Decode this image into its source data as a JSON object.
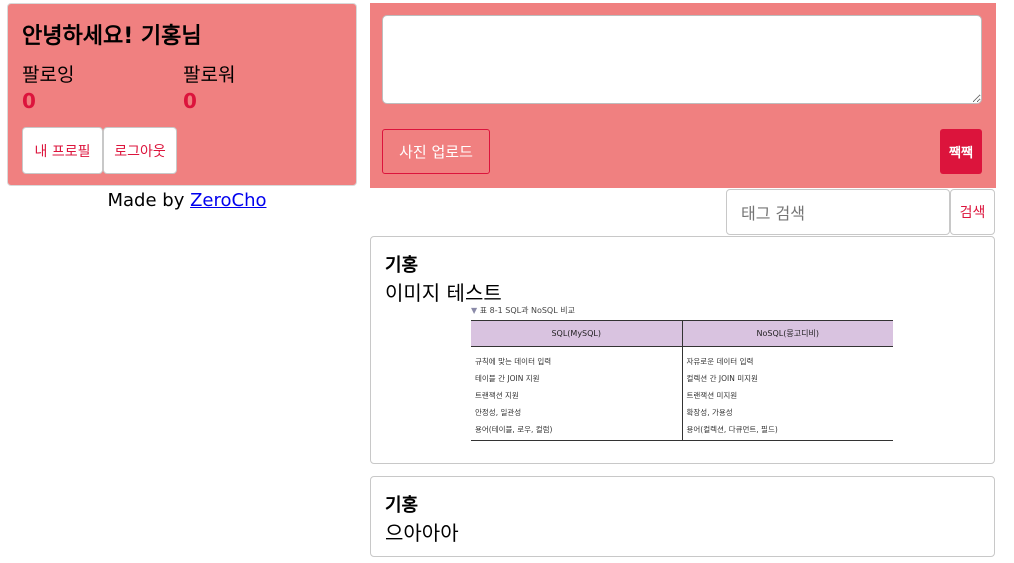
{
  "profile": {
    "greeting": "안녕하세요! 기홍님",
    "following_label": "팔로잉",
    "following_count": "0",
    "follower_label": "팔로워",
    "follower_count": "0",
    "my_profile_button": "내 프로필",
    "logout_button": "로그아웃"
  },
  "footer": {
    "made_by_prefix": "Made by ",
    "made_by_link": "ZeroCho"
  },
  "composer": {
    "textarea_value": "",
    "upload_button": "사진 업로드",
    "submit_button": "짹짹"
  },
  "search": {
    "placeholder": "태그 검색",
    "button": "검색"
  },
  "posts": [
    {
      "author": "기홍",
      "content": "이미지 테스트",
      "image": {
        "caption_marker": "▼",
        "caption_number": "표 8-1",
        "caption_title": "SQL과 NoSQL 비교",
        "headers": [
          "SQL(MySQL)",
          "NoSQL(몽고디비)"
        ],
        "rows_sql": [
          "규칙에 맞는 데이터 입력",
          "테이블 간 JOIN 지원",
          "트랜잭션 지원",
          "안정성, 일관성",
          "용어(테이블, 로우, 컬럼)"
        ],
        "rows_nosql": [
          "자유로운 데이터 입력",
          "컬렉션 간 JOIN 미지원",
          "트랜잭션 미지원",
          "확장성, 가용성",
          "용어(컬렉션, 다큐먼트, 필드)"
        ]
      }
    },
    {
      "author": "기홍",
      "content": "으아아아"
    }
  ],
  "colors": {
    "card_bg": "#f08080",
    "accent": "#dc143c"
  }
}
